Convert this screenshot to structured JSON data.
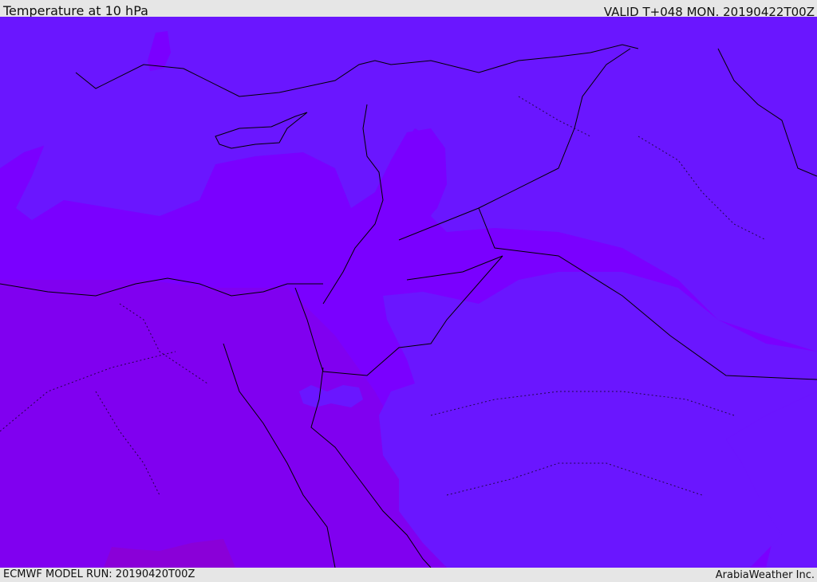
{
  "header": {
    "title": "Temperature at 10 hPa",
    "valid": "VALID T+048 MON. 20190422T00Z"
  },
  "footer": {
    "model_run": "ECMWF MODEL RUN: 20190420T00Z",
    "credit": "ArabiaWeather Inc."
  },
  "map": {
    "field": "temperature",
    "level": "10 hPa",
    "colors": {
      "cold_band": "#6a16ff",
      "mid_band": "#7a00ff",
      "warm_band": "#8000f0",
      "warm_spot": "#8a00d8",
      "borders": "#000000"
    }
  }
}
